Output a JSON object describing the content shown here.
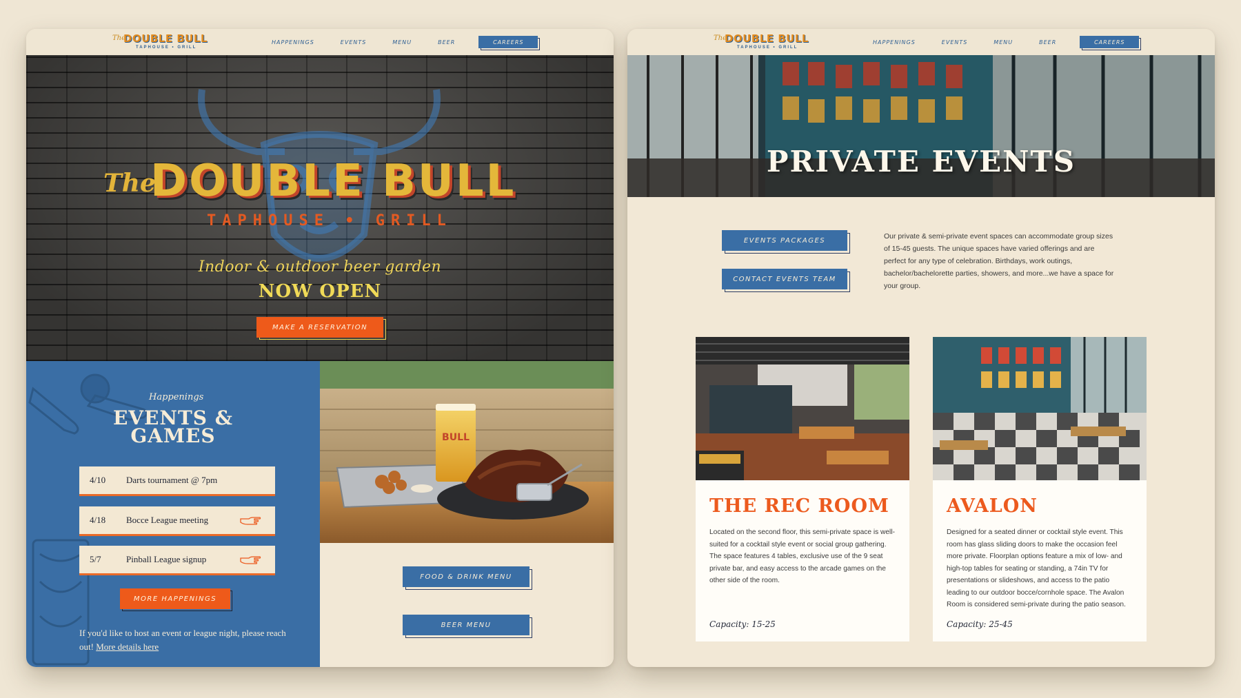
{
  "left_page": {
    "header": {
      "logo": {
        "the": "The",
        "name": "DOUBLE BULL",
        "sub": "TAPHOUSE • GRILL"
      },
      "nav": [
        "HAPPENINGS",
        "EVENTS",
        "MENU",
        "BEER"
      ],
      "careers_label": "CAREERS"
    },
    "hero": {
      "the": "The",
      "title": "DOUBLE BULL",
      "subtitle": "TAPHOUSE • GRILL",
      "line1": "Indoor & outdoor beer garden",
      "line2": "NOW OPEN",
      "reserve_label": "MAKE A RESERVATION"
    },
    "happenings": {
      "kicker": "Happenings",
      "title_line1": "EVENTS &",
      "title_line2": "GAMES",
      "events": [
        {
          "date": "4/10",
          "name": "Darts tournament @ 7pm",
          "icon": ""
        },
        {
          "date": "4/18",
          "name": "Bocce League meeting",
          "icon": "pointing-hand-icon"
        },
        {
          "date": "5/7",
          "name": "Pinball League signup",
          "icon": "pointing-hand-icon"
        }
      ],
      "more_label": "MORE HAPPENINGS",
      "note": "If you'd like to host an event or league night, please reach out!",
      "note_link": "More details here"
    },
    "menus": {
      "food_label": "FOOD & DRINK MENU",
      "beer_label": "BEER MENU"
    }
  },
  "right_page": {
    "header": {
      "logo": {
        "the": "The",
        "name": "DOUBLE BULL",
        "sub": "TAPHOUSE • GRILL"
      },
      "nav": [
        "HAPPENINGS",
        "EVENTS",
        "MENU",
        "BEER"
      ],
      "careers_label": "CAREERS"
    },
    "hero_title": "PRIVATE EVENTS",
    "packages_label": "EVENTS PACKAGES",
    "contact_label": "CONTACT EVENTS TEAM",
    "description": "Our private & semi-private event spaces can accommodate group sizes of 15-45 guests. The unique spaces have varied offerings and are perfect for any type of celebration. Birthdays, work outings, bachelor/bachelorette parties, showers, and more...we have a space for your group.",
    "rooms": [
      {
        "name": "THE REC ROOM",
        "description": "Located on the second floor, this semi-private space is well-suited for a cocktail style event or social group gathering. The space features 4 tables, exclusive use of the 9 seat private bar, and easy access to the arcade games on the other side of the room.",
        "capacity": "Capacity: 15-25"
      },
      {
        "name": "AVALON",
        "description": "Designed for a seated dinner or cocktail style event. This room has glass sliding doors to make the occasion feel more private. Floorplan options feature a mix of low- and high-top tables for seating or standing, a 74in TV for presentations or slideshows, and access to the patio leading to our outdoor bocce/cornhole space. The Avalon Room is considered semi-private during the patio season.",
        "capacity": "Capacity: 25-45"
      }
    ]
  },
  "colors": {
    "cream": "#f2e8d6",
    "blue": "#3a6ea5",
    "orange": "#ee5a1a",
    "gold": "#e4b73a",
    "navy": "#1f2433"
  }
}
